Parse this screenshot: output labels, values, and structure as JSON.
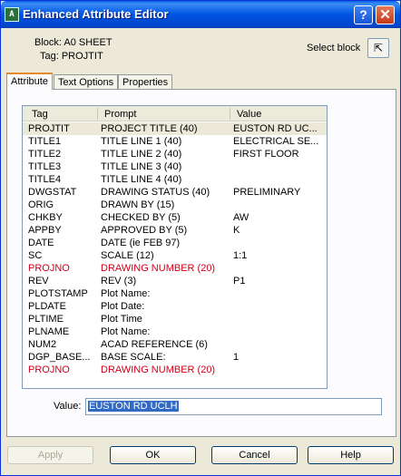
{
  "window": {
    "title": "Enhanced Attribute Editor",
    "app_icon": "A"
  },
  "titlebar": {
    "help": "?",
    "close": "✕"
  },
  "info": {
    "block": "Block: A0 SHEET",
    "tag": "Tag: PROJTIT",
    "select_block": "Select block"
  },
  "tabs": [
    "Attribute",
    "Text Options",
    "Properties"
  ],
  "columns": [
    "Tag",
    "Prompt",
    "Value"
  ],
  "rows": [
    {
      "tag": "PROJTIT",
      "prompt": "PROJECT TITLE (40)",
      "value": "EUSTON RD UC..."
    },
    {
      "tag": "TITLE1",
      "prompt": "TITLE LINE 1 (40)",
      "value": "ELECTRICAL SE..."
    },
    {
      "tag": "TITLE2",
      "prompt": "TITLE LINE 2 (40)",
      "value": "FIRST FLOOR"
    },
    {
      "tag": "TITLE3",
      "prompt": "TITLE LINE 3 (40)",
      "value": ""
    },
    {
      "tag": "TITLE4",
      "prompt": "TITLE LINE 4 (40)",
      "value": ""
    },
    {
      "tag": "DWGSTAT",
      "prompt": "DRAWING STATUS (40)",
      "value": "PRELIMINARY"
    },
    {
      "tag": "ORIG",
      "prompt": "DRAWN BY (15)",
      "value": ""
    },
    {
      "tag": "CHKBY",
      "prompt": "CHECKED BY (5)",
      "value": "AW"
    },
    {
      "tag": "APPBY",
      "prompt": "APPROVED BY (5)",
      "value": "K"
    },
    {
      "tag": "DATE",
      "prompt": "DATE (ie FEB 97)",
      "value": ""
    },
    {
      "tag": "SC",
      "prompt": "SCALE (12)",
      "value": "1:1"
    },
    {
      "tag": "PROJNO",
      "prompt": "DRAWING NUMBER (20)",
      "value": ""
    },
    {
      "tag": "REV",
      "prompt": "REV (3)",
      "value": "P1"
    },
    {
      "tag": "PLOTSTAMP",
      "prompt": "Plot Name:",
      "value": ""
    },
    {
      "tag": "PLDATE",
      "prompt": "Plot Date:",
      "value": ""
    },
    {
      "tag": "PLTIME",
      "prompt": "Plot Time",
      "value": ""
    },
    {
      "tag": "PLNAME",
      "prompt": "Plot Name:",
      "value": ""
    },
    {
      "tag": "NUM2",
      "prompt": "ACAD REFERENCE (6)",
      "value": ""
    },
    {
      "tag": "DGP_BASE...",
      "prompt": "BASE SCALE:",
      "value": "1"
    },
    {
      "tag": "PROJNO",
      "prompt": "DRAWING NUMBER (20)",
      "value": ""
    }
  ],
  "red_rows": [
    11,
    19
  ],
  "selected_row": 0,
  "value_field": {
    "label": "Value:",
    "value": "EUSTON RD UCLH"
  },
  "buttons": {
    "apply": "Apply",
    "ok": "OK",
    "cancel": "Cancel",
    "help": "Help"
  },
  "colors": {
    "title_bar": "#0054e3",
    "red_text": "#d0001a",
    "selection": "#316ac5"
  }
}
